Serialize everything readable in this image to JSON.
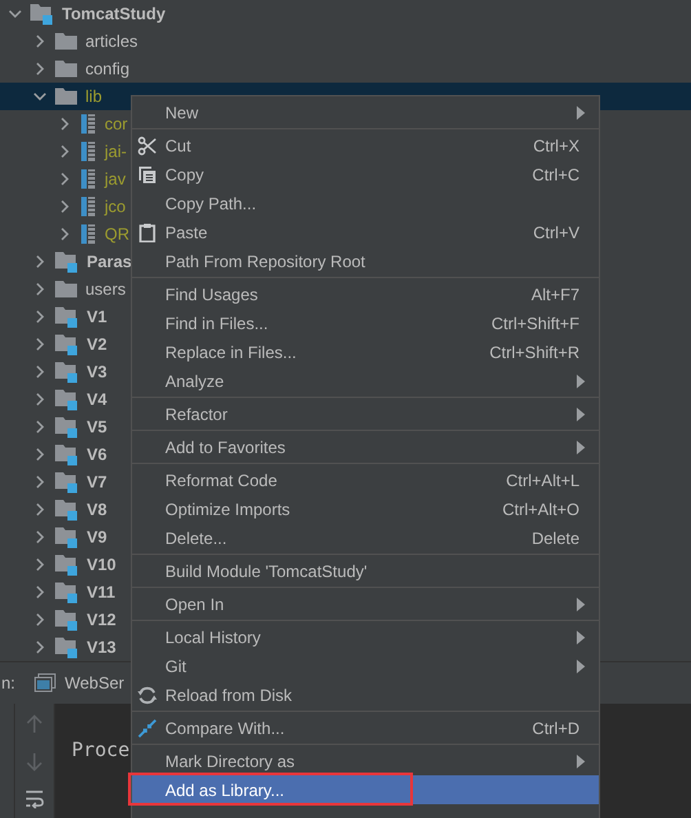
{
  "project_tree": [
    {
      "name": "TomcatStudy",
      "kind": "module",
      "expanded": true,
      "selected": false,
      "children": [
        {
          "name": "articles",
          "kind": "folder",
          "expanded": false,
          "selected": false
        },
        {
          "name": "config",
          "kind": "folder",
          "expanded": false,
          "selected": false
        },
        {
          "name": "lib",
          "kind": "folder",
          "expanded": true,
          "selected": true,
          "children": [
            {
              "name": "cor",
              "kind": "jar",
              "expanded": false,
              "selected": false
            },
            {
              "name": "jai-",
              "kind": "jar",
              "expanded": false,
              "selected": false
            },
            {
              "name": "jav",
              "kind": "jar",
              "expanded": false,
              "selected": false
            },
            {
              "name": "jco",
              "kind": "jar",
              "expanded": false,
              "selected": false
            },
            {
              "name": "QR",
              "kind": "jar",
              "expanded": false,
              "selected": false
            }
          ]
        },
        {
          "name": "Paras",
          "kind": "module",
          "expanded": false,
          "selected": false
        },
        {
          "name": "users",
          "kind": "folder",
          "expanded": false,
          "selected": false
        },
        {
          "name": "V1",
          "kind": "module",
          "expanded": false,
          "selected": false
        },
        {
          "name": "V2",
          "kind": "module",
          "expanded": false,
          "selected": false
        },
        {
          "name": "V3",
          "kind": "module",
          "expanded": false,
          "selected": false
        },
        {
          "name": "V4",
          "kind": "module",
          "expanded": false,
          "selected": false
        },
        {
          "name": "V5",
          "kind": "module",
          "expanded": false,
          "selected": false
        },
        {
          "name": "V6",
          "kind": "module",
          "expanded": false,
          "selected": false
        },
        {
          "name": "V7",
          "kind": "module",
          "expanded": false,
          "selected": false
        },
        {
          "name": "V8",
          "kind": "module",
          "expanded": false,
          "selected": false
        },
        {
          "name": "V9",
          "kind": "module",
          "expanded": false,
          "selected": false
        },
        {
          "name": "V10",
          "kind": "module",
          "expanded": false,
          "selected": false
        },
        {
          "name": "V11",
          "kind": "module",
          "expanded": false,
          "selected": false
        },
        {
          "name": "V12",
          "kind": "module",
          "expanded": false,
          "selected": false
        },
        {
          "name": "V13",
          "kind": "module",
          "expanded": false,
          "selected": false
        }
      ]
    }
  ],
  "run_panel": {
    "label": "n:",
    "tab": "WebSer",
    "console_text": "Proce"
  },
  "context_menu": [
    {
      "kind": "item",
      "label": "New",
      "submenu": true,
      "selected": false
    },
    {
      "kind": "separator"
    },
    {
      "kind": "item",
      "label": "Cut",
      "shortcut": "Ctrl+X",
      "selected": false
    },
    {
      "kind": "item",
      "label": "Copy",
      "shortcut": "Ctrl+C",
      "selected": false
    },
    {
      "kind": "item",
      "label": "Copy Path...",
      "selected": false
    },
    {
      "kind": "item",
      "label": "Paste",
      "shortcut": "Ctrl+V",
      "selected": false
    },
    {
      "kind": "item",
      "label": "Path From Repository Root",
      "selected": false
    },
    {
      "kind": "separator"
    },
    {
      "kind": "item",
      "label": "Find Usages",
      "shortcut": "Alt+F7",
      "selected": false
    },
    {
      "kind": "item",
      "label": "Find in Files...",
      "shortcut": "Ctrl+Shift+F",
      "selected": false
    },
    {
      "kind": "item",
      "label": "Replace in Files...",
      "shortcut": "Ctrl+Shift+R",
      "selected": false
    },
    {
      "kind": "item",
      "label": "Analyze",
      "submenu": true,
      "selected": false
    },
    {
      "kind": "separator"
    },
    {
      "kind": "item",
      "label": "Refactor",
      "submenu": true,
      "selected": false
    },
    {
      "kind": "separator"
    },
    {
      "kind": "item",
      "label": "Add to Favorites",
      "submenu": true,
      "selected": false
    },
    {
      "kind": "separator"
    },
    {
      "kind": "item",
      "label": "Reformat Code",
      "shortcut": "Ctrl+Alt+L",
      "selected": false
    },
    {
      "kind": "item",
      "label": "Optimize Imports",
      "shortcut": "Ctrl+Alt+O",
      "selected": false
    },
    {
      "kind": "item",
      "label": "Delete...",
      "shortcut": "Delete",
      "selected": false
    },
    {
      "kind": "separator"
    },
    {
      "kind": "item",
      "label": "Build Module 'TomcatStudy'",
      "selected": false
    },
    {
      "kind": "separator"
    },
    {
      "kind": "item",
      "label": "Open In",
      "submenu": true,
      "selected": false
    },
    {
      "kind": "separator"
    },
    {
      "kind": "item",
      "label": "Local History",
      "submenu": true,
      "selected": false
    },
    {
      "kind": "item",
      "label": "Git",
      "submenu": true,
      "selected": false
    },
    {
      "kind": "item",
      "label": "Reload from Disk",
      "selected": false
    },
    {
      "kind": "separator"
    },
    {
      "kind": "item",
      "label": "Compare With...",
      "shortcut": "Ctrl+D",
      "selected": false
    },
    {
      "kind": "separator"
    },
    {
      "kind": "item",
      "label": "Mark Directory as",
      "submenu": true,
      "selected": false
    },
    {
      "kind": "item",
      "label": "Add as Library...",
      "selected": true,
      "highlighted": true
    }
  ]
}
